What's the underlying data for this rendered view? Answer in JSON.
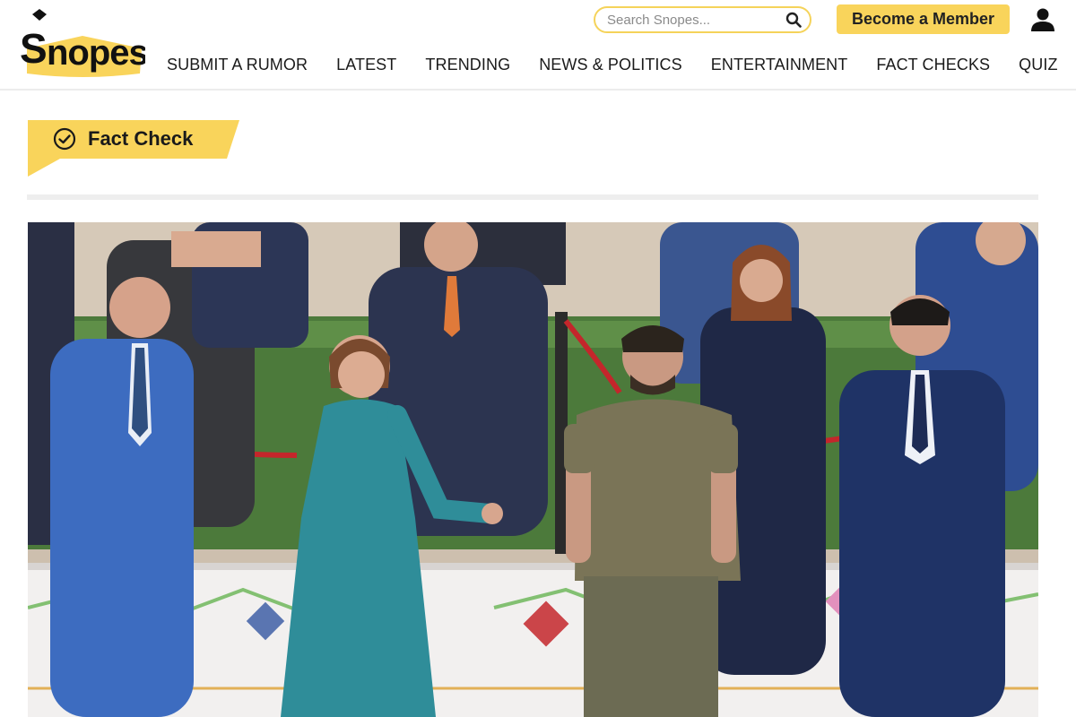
{
  "brand": {
    "name": "Snopes",
    "accent": "#f9d45b"
  },
  "search": {
    "placeholder": "Search Snopes...",
    "icon": "search-icon"
  },
  "header": {
    "member_label": "Become a Member",
    "user_icon": "user-icon"
  },
  "nav": {
    "items": [
      {
        "label": "SUBMIT A RUMOR"
      },
      {
        "label": "LATEST"
      },
      {
        "label": "TRENDING"
      },
      {
        "label": "NEWS & POLITICS"
      },
      {
        "label": "ENTERTAINMENT"
      },
      {
        "label": "FACT CHECKS"
      },
      {
        "label": "QUIZ"
      }
    ]
  },
  "article": {
    "category_label": "Fact Check",
    "category_icon": "check-circle-icon"
  },
  "photo": {
    "description_icon": "hero-photo"
  }
}
